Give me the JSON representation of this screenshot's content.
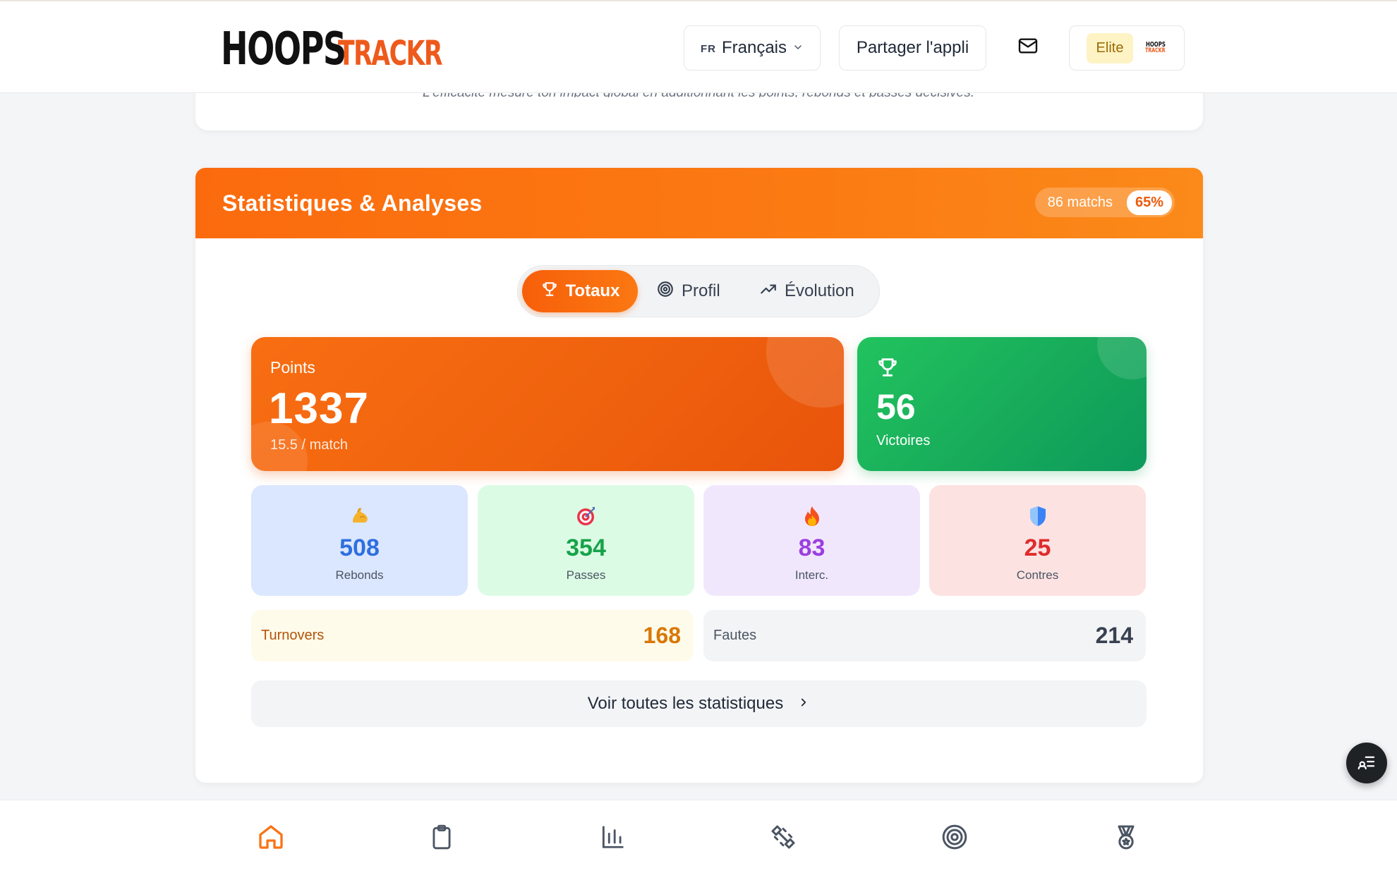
{
  "header": {
    "logo_part1": "HOOPS",
    "logo_part2": "TRACKR",
    "language_code": "FR",
    "language_label": "Français",
    "share_label": "Partager l'appli",
    "plan_badge": "Elite",
    "mini_logo_top": "HOOPS",
    "mini_logo_bottom": "TRACKR"
  },
  "top_card": {
    "note": "L'efficacité mesure ton impact global en additionnant les points, rebonds et passes décisives."
  },
  "stats": {
    "title": "Statistiques & Analyses",
    "matches": "86 matchs",
    "win_pct": "65%",
    "tabs": [
      {
        "label": "Totaux",
        "icon": "trophy-icon",
        "active": true
      },
      {
        "label": "Profil",
        "icon": "target-icon",
        "active": false
      },
      {
        "label": "Évolution",
        "icon": "trending-up-icon",
        "active": false
      }
    ],
    "points": {
      "label": "Points",
      "value": "1337",
      "per_match": "15.5 / match"
    },
    "wins": {
      "label": "Victoires",
      "value": "56"
    },
    "cards": [
      {
        "label": "Rebonds",
        "value": "508",
        "icon": "flexed-biceps-icon"
      },
      {
        "label": "Passes",
        "value": "354",
        "icon": "direct-hit-icon"
      },
      {
        "label": "Interc.",
        "value": "83",
        "icon": "fire-icon"
      },
      {
        "label": "Contres",
        "value": "25",
        "icon": "shield-icon"
      }
    ],
    "turnovers": {
      "label": "Turnovers",
      "value": "168"
    },
    "fouls": {
      "label": "Fautes",
      "value": "214"
    },
    "see_all": "Voir toutes les statistiques"
  },
  "colors": {
    "brand_orange": "#f97316",
    "win_green": "#16a34a",
    "rebounds_blue": "#2f6fe0",
    "passes_green": "#17a34a",
    "steals_purple": "#9b3fe0",
    "blocks_red": "#e02b2b"
  },
  "bottom_nav": [
    {
      "icon": "home-icon",
      "active": true
    },
    {
      "icon": "clipboard-icon",
      "active": false
    },
    {
      "icon": "bar-chart-icon",
      "active": false
    },
    {
      "icon": "dumbbell-icon",
      "active": false
    },
    {
      "icon": "target-icon",
      "active": false
    },
    {
      "icon": "medal-icon",
      "active": false
    }
  ]
}
